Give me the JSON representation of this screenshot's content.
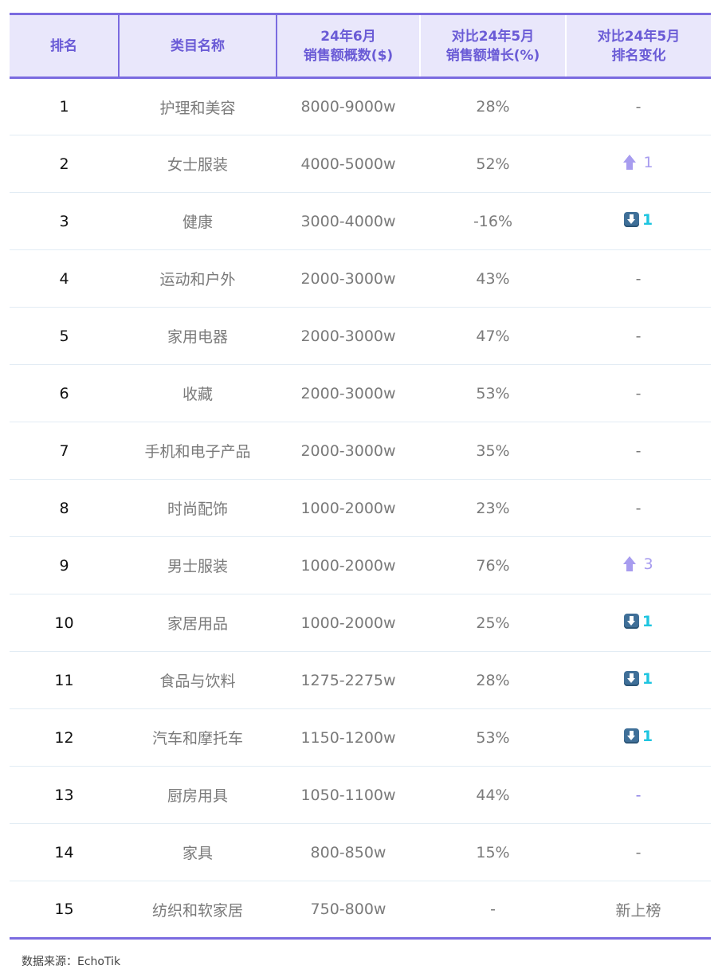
{
  "header": {
    "rank": "排名",
    "category": "类目名称",
    "sales_line1": "24年6月",
    "sales_line2": "销售额概数($)",
    "growth_line1": "对比24年5月",
    "growth_line2": "销售额增长(%)",
    "change_line1": "对比24年5月",
    "change_line2": "排名变化"
  },
  "rows": [
    {
      "rank": "1",
      "category": "护理和美容",
      "sales": "8000-9000w",
      "growth": "28%",
      "change": "-"
    },
    {
      "rank": "2",
      "category": "女士服装",
      "sales": "4000-5000w",
      "growth": "52%",
      "change": "1"
    },
    {
      "rank": "3",
      "category": "健康",
      "sales": "3000-4000w",
      "growth": "-16%",
      "change": "1"
    },
    {
      "rank": "4",
      "category": "运动和户外",
      "sales": "2000-3000w",
      "growth": "43%",
      "change": "-"
    },
    {
      "rank": "5",
      "category": "家用电器",
      "sales": "2000-3000w",
      "growth": "47%",
      "change": "-"
    },
    {
      "rank": "6",
      "category": "收藏",
      "sales": "2000-3000w",
      "growth": "53%",
      "change": "-"
    },
    {
      "rank": "7",
      "category": "手机和电子产品",
      "sales": "2000-3000w",
      "growth": "35%",
      "change": "-"
    },
    {
      "rank": "8",
      "category": "时尚配饰",
      "sales": "1000-2000w",
      "growth": "23%",
      "change": "-"
    },
    {
      "rank": "9",
      "category": "男士服装",
      "sales": "1000-2000w",
      "growth": "76%",
      "change": "3"
    },
    {
      "rank": "10",
      "category": "家居用品",
      "sales": "1000-2000w",
      "growth": "25%",
      "change": "1"
    },
    {
      "rank": "11",
      "category": "食品与饮料",
      "sales": "1275-2275w",
      "growth": "28%",
      "change": "1"
    },
    {
      "rank": "12",
      "category": "汽车和摩托车",
      "sales": "1150-1200w",
      "growth": "53%",
      "change": "1"
    },
    {
      "rank": "13",
      "category": "厨房用具",
      "sales": "1050-1100w",
      "growth": "44%",
      "change": "-"
    },
    {
      "rank": "14",
      "category": "家具",
      "sales": "800-850w",
      "growth": "15%",
      "change": "-"
    },
    {
      "rank": "15",
      "category": "纺织和软家居",
      "sales": "750-800w",
      "growth": "-",
      "change": "新上榜"
    }
  ],
  "source": "数据来源：EchoTik",
  "colors": {
    "accent": "#7b6be0",
    "header_bg": "#e9e7fb",
    "up": "#a79cef",
    "down_num": "#1ec5e0"
  }
}
